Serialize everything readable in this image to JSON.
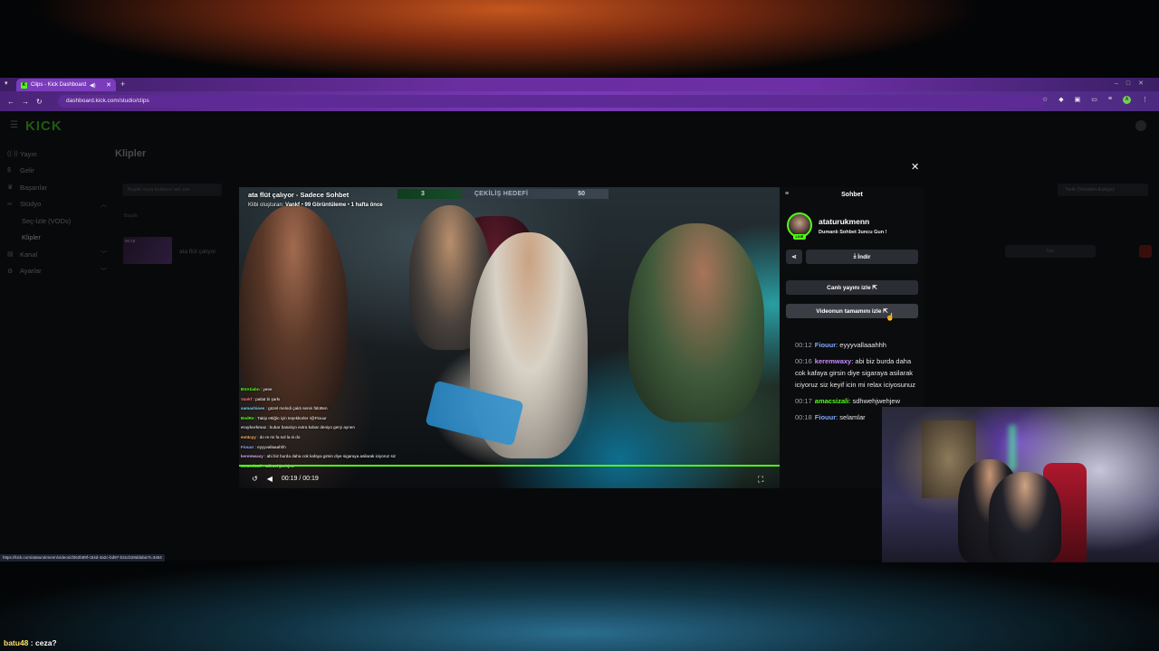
{
  "browser": {
    "tab_title": "Clips - Kick Dashboard",
    "tab_favicon": "K",
    "url": "dashboard.kick.com/studio/clips"
  },
  "dashboard": {
    "logo": "KICK",
    "nav": [
      {
        "label": "Yayın",
        "icon": "broadcast-icon"
      },
      {
        "label": "Gelir",
        "icon": "dollar-icon"
      },
      {
        "label": "Başarılar",
        "icon": "trophy-icon"
      },
      {
        "label": "Stüdyo",
        "icon": "studio-icon"
      },
      {
        "label": "Seç-İzle (VODs)"
      },
      {
        "label": "Klipler"
      },
      {
        "label": "Kanal",
        "icon": "channel-icon"
      },
      {
        "label": "Ayarlar",
        "icon": "gear-icon"
      }
    ],
    "page_title": "Klipler",
    "search_placeholder": "Başlık veya kullanıcı adı ara",
    "sort_label": "Tarih (Yeniden-Eskiye)",
    "table_header": "Başlık",
    "row": {
      "thumb_duration": "00:19",
      "title": "ata flüt çalıyor",
      "action": "İzle"
    }
  },
  "status_url": "https://kick.com/ataturukmenn/videos/d362b89f-c54d-4a2c-bd97-b31cb28ddaba?t=3464",
  "player": {
    "title": "ata flüt çalıyor - Sadece Sohbet",
    "meta_prefix": "Klibi oluşturan:",
    "creator": "Vankf",
    "views": "99 Görüntüleme",
    "age": "1 hafta önce",
    "goal": {
      "left": "3",
      "label": "ÇEKİLİŞ HEDEFİ",
      "right": "50"
    },
    "time": "00:19 / 00:19",
    "progress_percent": 100,
    "overlay_chat": [
      {
        "user": "BSAtiabn",
        "text": "yeee",
        "color": "#53fc18"
      },
      {
        "user": "Vankf",
        "text": "patlat bi şarkı",
        "color": "#ff7a7a"
      },
      {
        "user": "samachioes",
        "text": "güzel melodi çaldı senin fülütten",
        "color": "#7ad7ff"
      },
      {
        "user": "BedRe",
        "text": "Takip ettiğin için teşekkürler !@Fiouur",
        "color": "#53fc18"
      },
      {
        "user": "eraykorkmaz",
        "text": "kubar basalıyo extra kubar deniyo gerçi aynen",
        "color": "#cfcfcf"
      },
      {
        "user": "ext4cyy",
        "text": "do re mi fa sol la si do",
        "color": "#ffb86b"
      },
      {
        "user": "Fiouur",
        "text": "eyyyvallaaahhh",
        "color": "#8fb4ff"
      },
      {
        "user": "keremwaxy",
        "text": "abi biz burda daha cok kafaya girsin diye sigaraya asilarak iciyoruz siz",
        "color": "#d7a6ff"
      },
      {
        "user": "amacsizali",
        "text": "sdhwehjwehjew",
        "color": "#53fc18"
      }
    ]
  },
  "chat_panel": {
    "title": "Sohbet",
    "streamer": "ataturukmenn",
    "stream_title": "Dumanlı Sohbet 3uncu Gun !",
    "live_badge": "LIVE",
    "download_label": "İndir",
    "watch_live_label": "Canlı yayını izle",
    "watch_full_label": "Videonun tamamını izle",
    "messages": [
      {
        "time": "00:12",
        "user": "Fiouur",
        "text": "eyyyvallaaahhh",
        "color": "#7fa8ff"
      },
      {
        "time": "00:16",
        "user": "keremwaxy",
        "text": "abi biz burda daha cok kafaya girsin diye sigaraya asilarak iciyoruz siz keyif icin mi relax iciyosunuz",
        "color": "#c58cff"
      },
      {
        "time": "00:17",
        "user": "amacsizali",
        "text": "sdhwehjwehjew",
        "color": "#53fc18"
      },
      {
        "time": "00:18",
        "user": "Fiouur",
        "text": "selamlar",
        "color": "#7fa8ff"
      }
    ]
  },
  "stream_chat": {
    "user": "batu48",
    "text": "ceza?"
  },
  "colors": {
    "accent": "#53fc18",
    "tabbar": "#6a2ea0"
  }
}
